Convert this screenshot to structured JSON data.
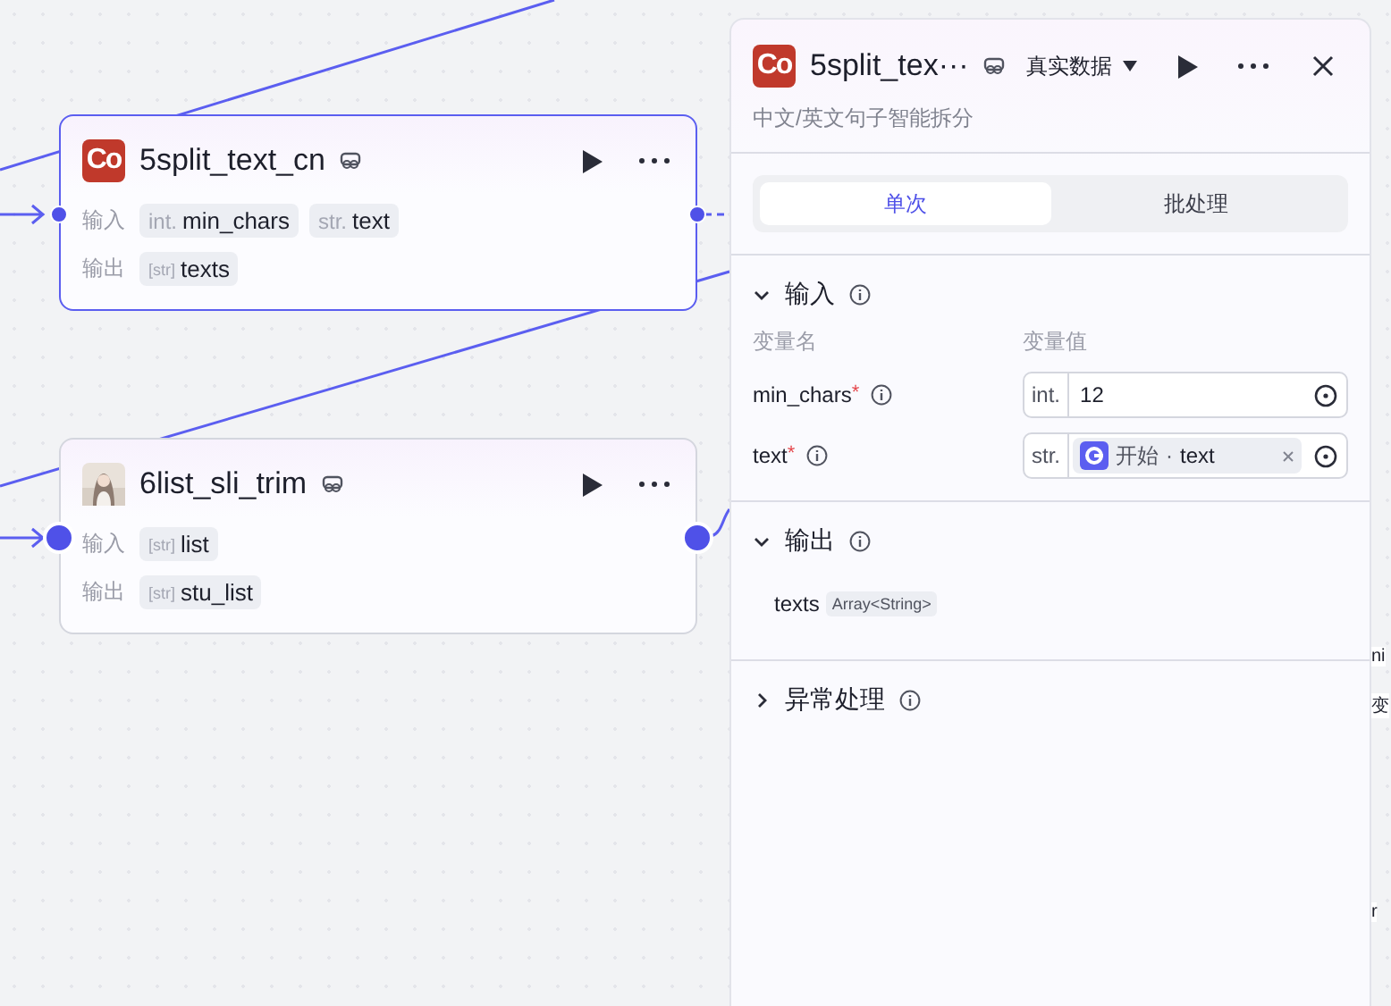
{
  "nodes": [
    {
      "kind": "code",
      "icon_text": "Co",
      "title": "5split_text_cn",
      "selected": true,
      "input_label": "输入",
      "output_label": "输出",
      "inputs": [
        {
          "type": "int.",
          "name": "min_chars"
        },
        {
          "type": "str.",
          "name": "text"
        }
      ],
      "outputs": [
        {
          "type": "[str]",
          "name": "texts"
        }
      ]
    },
    {
      "kind": "picture",
      "title": "6list_sli_trim",
      "selected": false,
      "input_label": "输入",
      "output_label": "输出",
      "inputs": [
        {
          "type": "[str]",
          "name": "list"
        }
      ],
      "outputs": [
        {
          "type": "[str]",
          "name": "stu_list"
        }
      ]
    }
  ],
  "edge_fragments": [
    "ni",
    "变",
    "r"
  ],
  "panel": {
    "icon_text": "Co",
    "title": "5split_tex···",
    "data_mode": "真实数据",
    "subtitle": "中文/英文句子智能拆分",
    "tabs": [
      {
        "label": "单次",
        "selected": true
      },
      {
        "label": "批处理",
        "selected": false
      }
    ],
    "input": {
      "title": "输入",
      "expanded": true,
      "required_mark": "*",
      "name_header": "变量名",
      "value_header": "变量值",
      "rows": [
        {
          "name": "min_chars",
          "required": true,
          "type": "int.",
          "kind": "literal",
          "value": "12"
        },
        {
          "name": "text",
          "required": true,
          "type": "str.",
          "kind": "reference",
          "source": "开始",
          "separator": "·",
          "field": "text"
        }
      ]
    },
    "output": {
      "title": "输出",
      "expanded": true,
      "vars": [
        {
          "name": "texts",
          "type": "Array<String>"
        }
      ]
    },
    "error": {
      "title": "异常处理",
      "expanded": false
    }
  }
}
